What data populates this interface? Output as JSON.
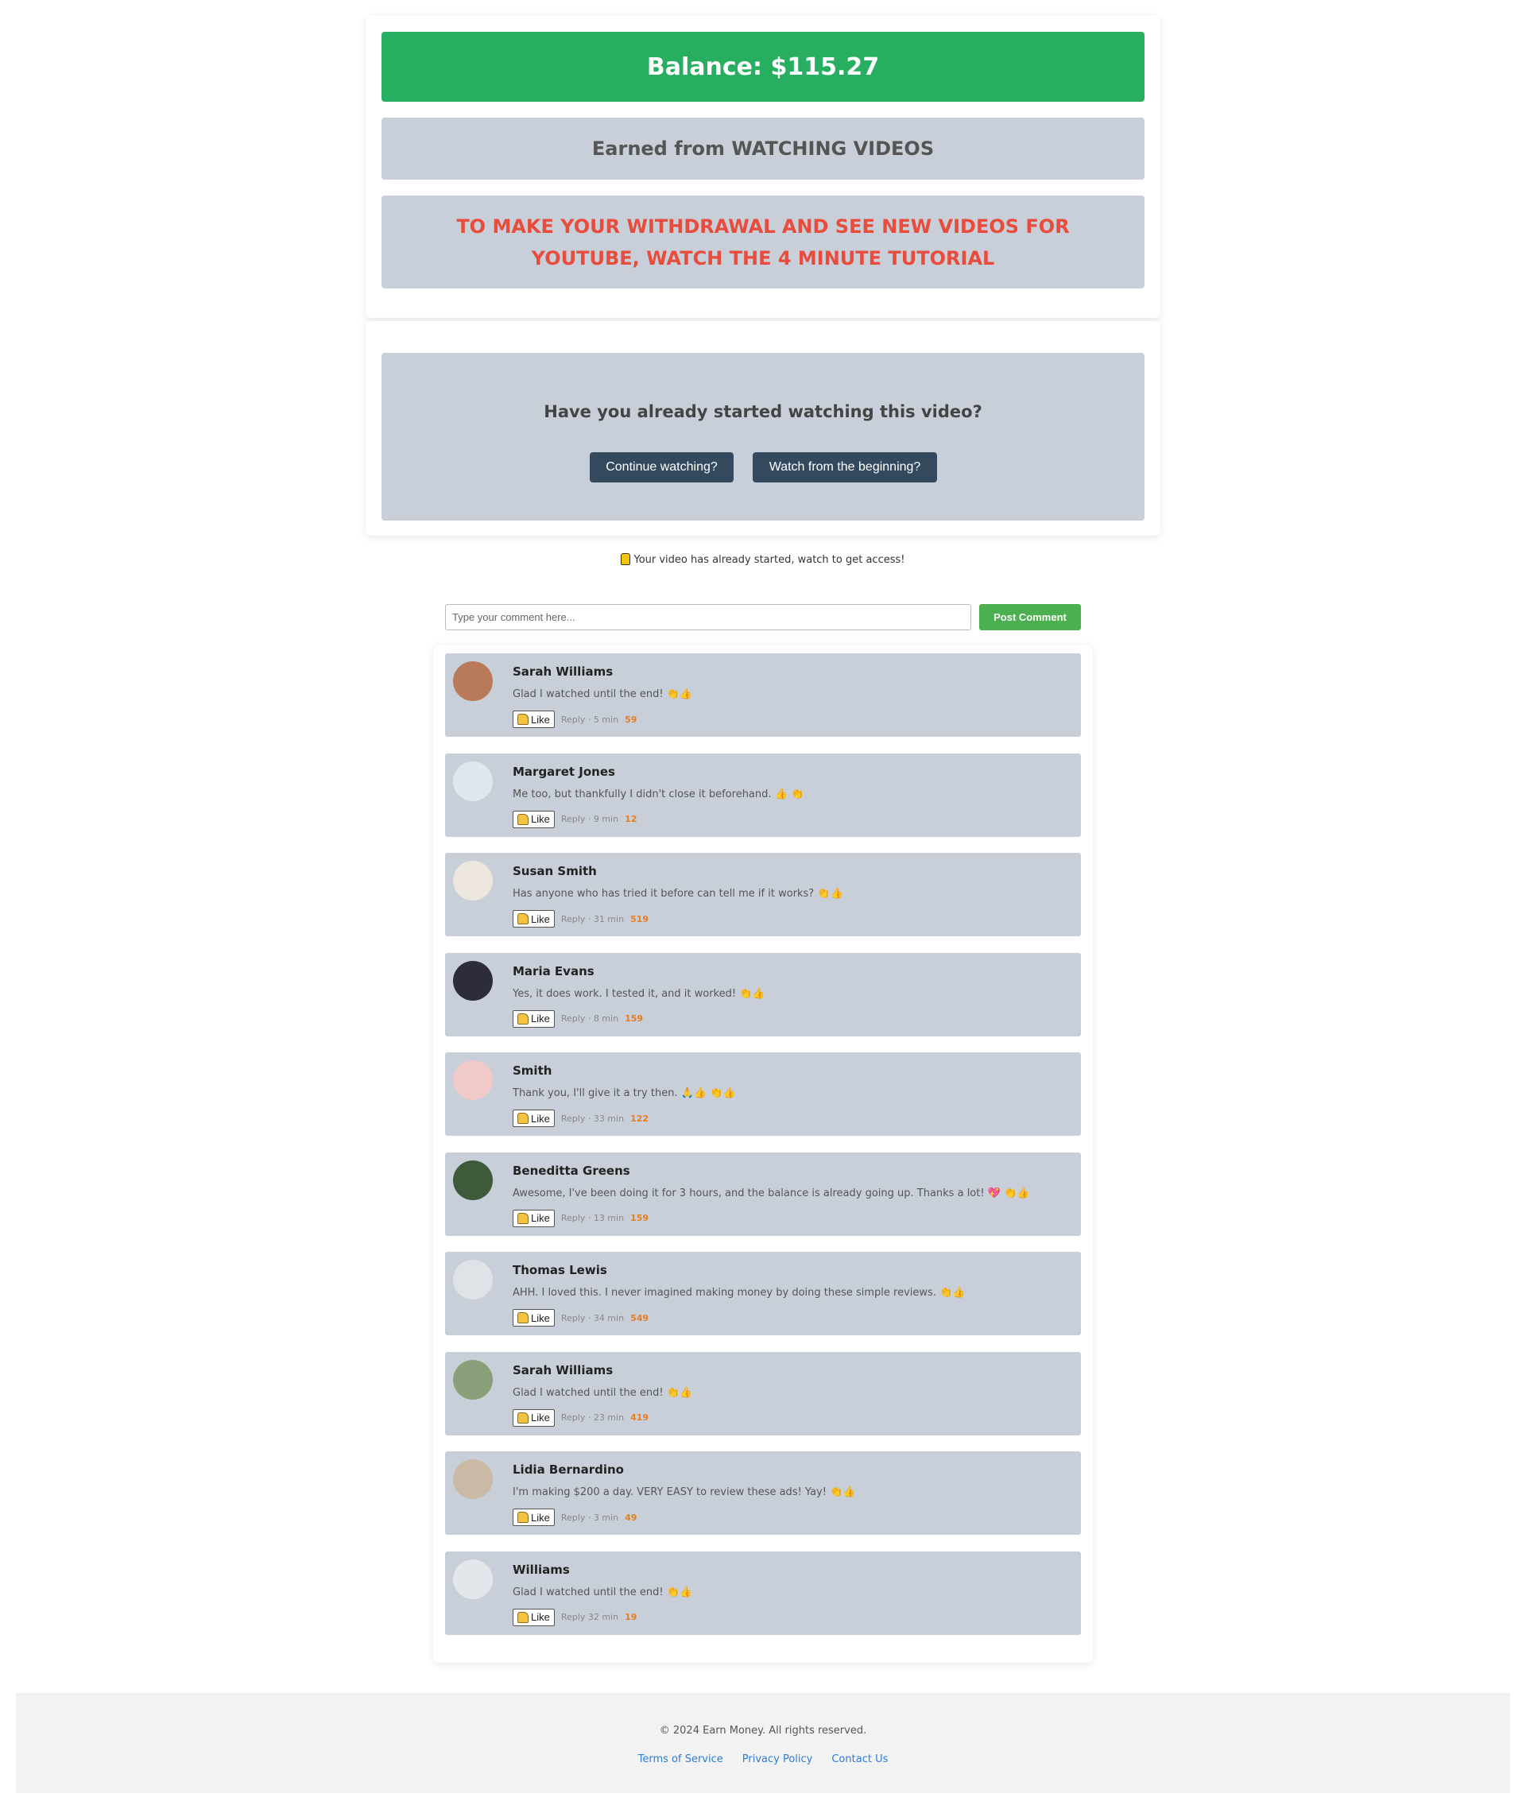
{
  "balance": {
    "label": "Balance: $115.27"
  },
  "earned": {
    "label": "Earned from WATCHING VIDEOS"
  },
  "notice": {
    "text": "TO MAKE YOUR WITHDRAWAL AND SEE NEW VIDEOS FOR YOUTUBE, WATCH THE 4 MINUTE TUTORIAL"
  },
  "video_prompt": {
    "question": "Have you already started watching this video?",
    "continue_label": "Continue watching?",
    "restart_label": "Watch from the beginning?"
  },
  "status": {
    "text": "Your video has already started, watch to get access!",
    "icon": "lock-icon"
  },
  "comment_form": {
    "placeholder": "Type your comment here...",
    "post_label": "Post Comment"
  },
  "comments": [
    {
      "name": "Sarah Williams",
      "text": "Glad I watched until the end!",
      "emojis": "👏👍",
      "like_label": "Like",
      "meta": "Reply · 5 min",
      "likes": "59",
      "avatar_color": "#b97a5a"
    },
    {
      "name": "Margaret Jones",
      "text": "Me too, but thankfully I didn't close it beforehand.",
      "emojis": "👍 👏",
      "like_label": "Like",
      "meta": "Reply · 9 min",
      "likes": "12",
      "avatar_color": "#dfe6ee"
    },
    {
      "name": "Susan Smith",
      "text": "Has anyone who has tried it before can tell me if it works?",
      "emojis": "👏👍",
      "like_label": "Like",
      "meta": "Reply · 31 min",
      "likes": "519",
      "avatar_color": "#eee7e0"
    },
    {
      "name": "Maria Evans",
      "text": "Yes, it does work. I tested it, and it worked!",
      "emojis": "👏👍",
      "like_label": "Like",
      "meta": "Reply · 8 min",
      "likes": "159",
      "avatar_color": "#2c2c3a"
    },
    {
      "name": "Smith",
      "text": "Thank you, I'll give it a try then.",
      "emojis": "🙏👍 👏👍",
      "like_label": "Like",
      "meta": "Reply · 33 min",
      "likes": "122",
      "avatar_color": "#f2c9c9"
    },
    {
      "name": "Beneditta Greens",
      "text": "Awesome, I've been doing it for 3 hours, and the balance is already going up. Thanks a lot!",
      "emojis": "💖 👏👍",
      "like_label": "Like",
      "meta": "Reply · 13 min",
      "likes": "159",
      "avatar_color": "#3d5a3a"
    },
    {
      "name": "Thomas Lewis",
      "text": "AHH. I loved this. I never imagined making money by doing these simple reviews.",
      "emojis": "👏👍",
      "like_label": "Like",
      "meta": "Reply · 34 min",
      "likes": "549",
      "avatar_color": "#dfe3e8"
    },
    {
      "name": "Sarah Williams",
      "text": "Glad I watched until the end!",
      "emojis": "👏👍",
      "like_label": "Like",
      "meta": "Reply · 23 min",
      "likes": "419",
      "avatar_color": "#8aa07a"
    },
    {
      "name": "Lidia Bernardino",
      "text": "I'm making $200 a day. VERY EASY to review these ads! Yay!",
      "emojis": "👏👍",
      "like_label": "Like",
      "meta": "Reply · 3 min",
      "likes": "49",
      "avatar_color": "#c9b9a5"
    },
    {
      "name": "Williams",
      "text": "Glad I watched until the end!",
      "emojis": "👏👍",
      "like_label": "Like",
      "meta": "Reply 32 min",
      "likes": "19",
      "avatar_color": "#e3e6ea"
    }
  ],
  "footer": {
    "copyright": "© 2024 Earn Money. All rights reserved.",
    "links": [
      "Terms of Service",
      "Privacy Policy",
      "Contact Us"
    ]
  },
  "colors": {
    "balance_green": "#27ae60",
    "panel_gray": "#c8cfd8",
    "notice_red": "#e74c3c",
    "button_dark": "#34495e",
    "post_green": "#4caf50",
    "likes_orange": "#e67e22",
    "link_blue": "#2e7dd7"
  }
}
